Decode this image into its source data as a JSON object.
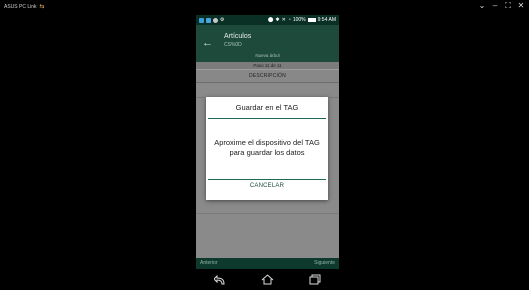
{
  "window": {
    "title": "ASUS PC Link",
    "controls": [
      "⌄",
      "–",
      "⛶",
      "✕"
    ]
  },
  "status_bar": {
    "signal": "100%",
    "time": "9:54 AM"
  },
  "app_bar": {
    "title": "Artículos",
    "subtitle": "CS%0D",
    "hint": "Nueva árbol"
  },
  "step": "Paso 11 de 11",
  "description_header": "DESCRIPCIÓN",
  "dialog": {
    "title": "Guardar en el TAG",
    "message": "Aproxime el dispositivo del TAG para guardar los datos",
    "cancel_label": "CANCELAR"
  },
  "bottom_bar": {
    "prev_label": "Anterior",
    "next_label": "Siguiente"
  },
  "colors": {
    "app_bar": "#1d4a3b",
    "status_bar": "#0a2f24",
    "accent": "#1d6b56"
  }
}
